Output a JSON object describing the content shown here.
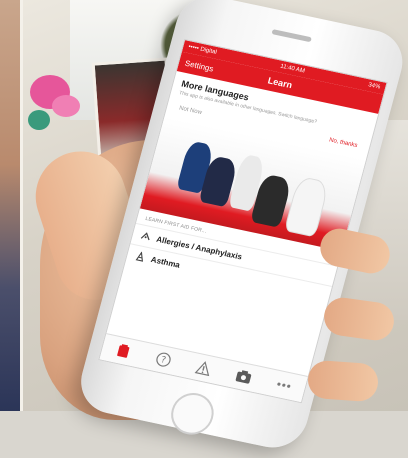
{
  "status": {
    "carrier": "••••• Digital",
    "time": "11:40 AM",
    "battery": "34%"
  },
  "nav": {
    "left": "Settings",
    "title": "Learn"
  },
  "banner": {
    "title": "More languages",
    "subtitle": "This app is also available in other languages. Switch language?",
    "later": "Not Now",
    "no": "No, thanks"
  },
  "section_label": "LEARN FIRST AID FOR...",
  "rows": [
    {
      "label": "Allergies / Anaphylaxis",
      "icon": "allergy-icon"
    },
    {
      "label": "Asthma",
      "icon": "asthma-icon"
    }
  ],
  "tabs": [
    {
      "name": "learn-tab-icon",
      "active": true
    },
    {
      "name": "help-tab-icon",
      "active": false
    },
    {
      "name": "emergency-tab-icon",
      "active": false
    },
    {
      "name": "camera-tab-icon",
      "active": false
    },
    {
      "name": "more-tab-icon",
      "active": false
    }
  ],
  "colors": {
    "accent": "#e01b22",
    "tab_inactive": "#7a7a7a"
  }
}
